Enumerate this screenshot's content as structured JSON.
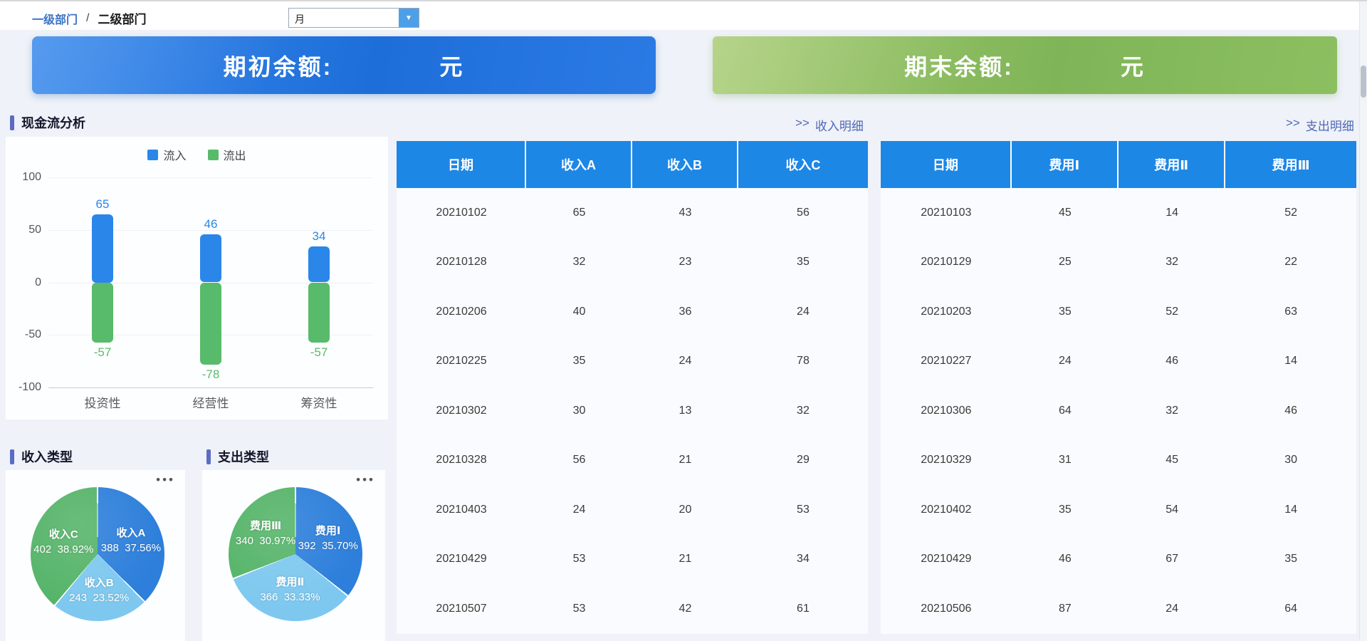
{
  "breadcrumb": {
    "level1": "一级部门",
    "separator": "/",
    "level2": "二级部门"
  },
  "period_select": {
    "value": "月",
    "arrow_icon": "▼"
  },
  "banners": {
    "opening": {
      "label": "期初余额:",
      "unit": "元"
    },
    "closing": {
      "label": "期末余额:",
      "unit": "元"
    }
  },
  "sections": {
    "cashflow_title": "现金流分析",
    "income_pie_title": "收入类型",
    "expense_pie_title": "支出类型"
  },
  "links": {
    "arrow": ">>",
    "income_detail": "收入明细",
    "expense_detail": "支出明细"
  },
  "pie_menu_icon": "•••",
  "colors": {
    "table_header_blue": "#1d87e6",
    "bar_inflow_blue": "#2b86e9",
    "bar_outflow_green": "#58bb6b",
    "pie_blue": "#2d7fdb",
    "pie_lightblue": "#7ec8ef",
    "pie_green": "#55b469",
    "banner_blue": "#2677e0",
    "banner_green": "#85bc60",
    "link_color": "#4f68b5"
  },
  "chart_data": [
    {
      "type": "bar",
      "title": "现金流分析",
      "categories": [
        "投资性",
        "经营性",
        "筹资性"
      ],
      "series": [
        {
          "name": "流入",
          "color": "#2b86e9",
          "values": [
            65,
            46,
            34
          ]
        },
        {
          "name": "流出",
          "color": "#58bb6b",
          "values": [
            -57,
            -78,
            -57
          ]
        }
      ],
      "ylim": [
        -100,
        100
      ],
      "yticks": [
        100,
        50,
        0,
        -50,
        -100
      ],
      "legend_position": "top",
      "grid": true
    },
    {
      "type": "pie",
      "title": "收入类型",
      "slices": [
        {
          "name": "收入A",
          "value": 388,
          "pct": "37.56",
          "color": "#2d7fdb"
        },
        {
          "name": "收入B",
          "value": 243,
          "pct": "23.52",
          "color": "#7ec8ef"
        },
        {
          "name": "收入C",
          "value": 402,
          "pct": "38.92",
          "color": "#55b469"
        }
      ]
    },
    {
      "type": "pie",
      "title": "支出类型",
      "slices": [
        {
          "name": "费用Ⅰ",
          "value": 392,
          "pct": "35.70",
          "color": "#2d7fdb"
        },
        {
          "name": "费用Ⅱ",
          "value": 366,
          "pct": "33.33",
          "color": "#7ec8ef"
        },
        {
          "name": "费用Ⅲ",
          "value": 340,
          "pct": "30.97",
          "color": "#55b469"
        }
      ]
    }
  ],
  "income_table": {
    "headers": [
      "日期",
      "收入A",
      "收入B",
      "收入C"
    ],
    "rows": [
      [
        "20210102",
        "65",
        "43",
        "56"
      ],
      [
        "20210128",
        "32",
        "23",
        "35"
      ],
      [
        "20210206",
        "40",
        "36",
        "24"
      ],
      [
        "20210225",
        "35",
        "24",
        "78"
      ],
      [
        "20210302",
        "30",
        "13",
        "32"
      ],
      [
        "20210328",
        "56",
        "21",
        "29"
      ],
      [
        "20210403",
        "24",
        "20",
        "53"
      ],
      [
        "20210429",
        "53",
        "21",
        "34"
      ],
      [
        "20210507",
        "53",
        "42",
        "61"
      ]
    ]
  },
  "expense_table": {
    "headers": [
      "日期",
      "费用Ⅰ",
      "费用Ⅱ",
      "费用Ⅲ"
    ],
    "rows": [
      [
        "20210103",
        "45",
        "14",
        "52"
      ],
      [
        "20210129",
        "25",
        "32",
        "22"
      ],
      [
        "20210203",
        "35",
        "52",
        "63"
      ],
      [
        "20210227",
        "24",
        "46",
        "14"
      ],
      [
        "20210306",
        "64",
        "32",
        "46"
      ],
      [
        "20210329",
        "31",
        "45",
        "30"
      ],
      [
        "20210402",
        "35",
        "54",
        "14"
      ],
      [
        "20210429",
        "46",
        "67",
        "35"
      ],
      [
        "20210506",
        "87",
        "24",
        "64"
      ]
    ]
  }
}
